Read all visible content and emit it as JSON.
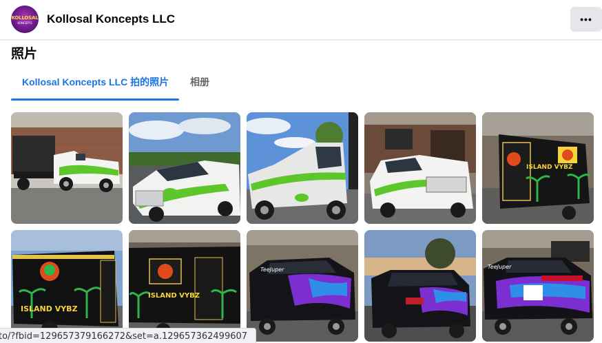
{
  "header": {
    "page_name": "Kollosal Koncepts LLC",
    "avatar_text": "KOLLOSAL",
    "avatar_subtext": "KONCEPTS",
    "more_label": "•••"
  },
  "section": {
    "title": "照片",
    "tabs": [
      {
        "label": "Kollosal Koncepts LLC 拍的照片",
        "active": true
      },
      {
        "label": "相册",
        "active": false
      }
    ]
  },
  "photos": [
    {
      "subject": "white pickup truck with dump trailer, building in background",
      "vehicle_text": ""
    },
    {
      "subject": "white pickup truck front angle, blue sky",
      "vehicle_text": ""
    },
    {
      "subject": "white pickup truck side, low angle",
      "vehicle_text": ""
    },
    {
      "subject": "white pickup truck parked at storefront",
      "vehicle_text": ""
    },
    {
      "subject": "black food trailer with palm tree wrap",
      "vehicle_text": "ISLAND VYBZ"
    },
    {
      "subject": "black food trailer with parrot graphic",
      "vehicle_text": "ISLAND VYBZ"
    },
    {
      "subject": "black food trailer rear, palm tree wrap",
      "vehicle_text": "ISLAND VYBZ"
    },
    {
      "subject": "black SUV with purple wrap, parked",
      "vehicle_text": ""
    },
    {
      "subject": "black SUV with purple wrap, rear view at dusk",
      "vehicle_text": ""
    },
    {
      "subject": "black SUV with purple wrap, side view",
      "vehicle_text": ""
    }
  ],
  "colors": {
    "accent": "#1b74e4",
    "truck_green": "#5cc62a",
    "wrap_purple": "#7b2fd1"
  },
  "status_bar": {
    "url": "to/?fbid=129657379166272&set=a.129657362499607"
  }
}
